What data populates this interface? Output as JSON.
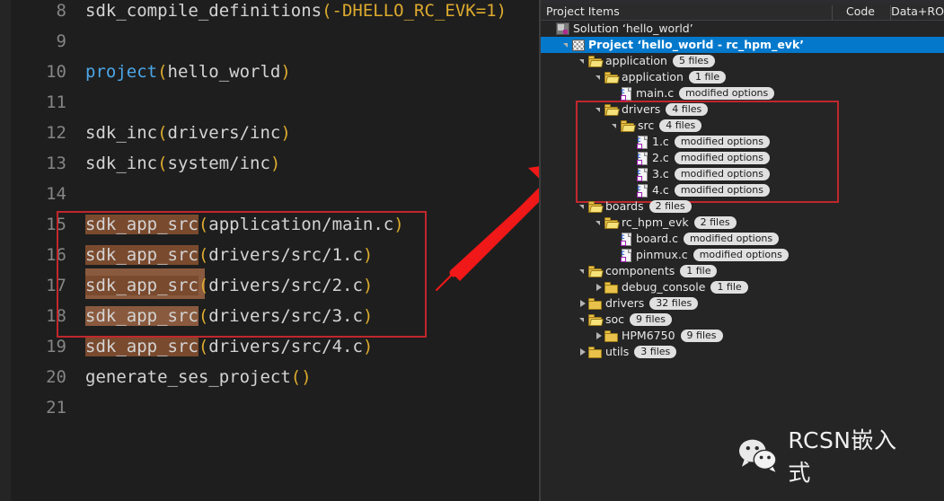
{
  "editor": {
    "lines": [
      {
        "num": "8",
        "parts": [
          {
            "t": "sdk_compile_definitions",
            "c": "plain"
          },
          {
            "t": "(-DHELLO_RC_EVK=1)",
            "c": "paren"
          }
        ]
      },
      {
        "num": "9",
        "parts": []
      },
      {
        "num": "10",
        "parts": [
          {
            "t": "project",
            "c": "fn"
          },
          {
            "t": "(",
            "c": "paren"
          },
          {
            "t": "hello_world",
            "c": "plain"
          },
          {
            "t": ")",
            "c": "paren"
          }
        ]
      },
      {
        "num": "11",
        "parts": []
      },
      {
        "num": "12",
        "parts": [
          {
            "t": "sdk_inc",
            "c": "plain"
          },
          {
            "t": "(",
            "c": "paren"
          },
          {
            "t": "drivers/inc",
            "c": "plain"
          },
          {
            "t": ")",
            "c": "paren"
          }
        ]
      },
      {
        "num": "13",
        "parts": [
          {
            "t": "sdk_inc",
            "c": "plain"
          },
          {
            "t": "(",
            "c": "paren"
          },
          {
            "t": "system/inc",
            "c": "plain"
          },
          {
            "t": ")",
            "c": "paren"
          }
        ]
      },
      {
        "num": "14",
        "parts": []
      },
      {
        "num": "15",
        "parts": [
          {
            "t": "sdk_app_src",
            "c": "sel"
          },
          {
            "t": "(",
            "c": "paren"
          },
          {
            "t": "application/main.c",
            "c": "plain"
          },
          {
            "t": ")",
            "c": "paren"
          }
        ]
      },
      {
        "num": "16",
        "parts": [
          {
            "t": "sdk_app_src",
            "c": "sel"
          },
          {
            "t": "(",
            "c": "paren"
          },
          {
            "t": "drivers/src/1.c",
            "c": "plain"
          },
          {
            "t": ")",
            "c": "paren"
          }
        ]
      },
      {
        "num": "17",
        "parts": [
          {
            "t": "sdk_app_src",
            "c": "sel"
          },
          {
            "t": "(",
            "c": "paren"
          },
          {
            "t": "drivers/src/2.c",
            "c": "plain"
          },
          {
            "t": ")",
            "c": "paren"
          }
        ]
      },
      {
        "num": "18",
        "parts": [
          {
            "t": "sdk_app_src",
            "c": "sellite"
          },
          {
            "t": "(",
            "c": "paren"
          },
          {
            "t": "drivers/src/3.c",
            "c": "plain"
          },
          {
            "t": ")",
            "c": "paren"
          }
        ]
      },
      {
        "num": "19",
        "parts": [
          {
            "t": "sdk_app_src",
            "c": "sel"
          },
          {
            "t": "(",
            "c": "paren"
          },
          {
            "t": "drivers/src/4.c",
            "c": "plain"
          },
          {
            "t": ")",
            "c": "paren"
          }
        ]
      },
      {
        "num": "20",
        "parts": [
          {
            "t": "generate_ses_project",
            "c": "plain"
          },
          {
            "t": "()",
            "c": "paren"
          }
        ]
      },
      {
        "num": "21",
        "parts": []
      }
    ],
    "annotation_color": "#c0272d",
    "selection_color": "#7a4a2e"
  },
  "panel": {
    "header": {
      "col_items": "Project Items",
      "col_code": "Code",
      "col_dataro": "Data+RO"
    },
    "selection_color": "#0479cc",
    "tree": [
      {
        "indent": 0,
        "twisty": "none",
        "icon": "solution-icon",
        "label": "Solution ‘hello_world’",
        "badge": "",
        "bold": false,
        "selected": false
      },
      {
        "indent": 1,
        "twisty": "open",
        "icon": "project-icon",
        "label": "Project ‘hello_world - rc_hpm_evk’",
        "badge": "",
        "bold": true,
        "selected": true
      },
      {
        "indent": 2,
        "twisty": "open",
        "icon": "folder-open-icon",
        "label": "application",
        "badge": "5 files",
        "bold": false,
        "selected": false
      },
      {
        "indent": 3,
        "twisty": "open",
        "icon": "folder-open-icon",
        "label": "application",
        "badge": "1 file",
        "bold": false,
        "selected": false
      },
      {
        "indent": 4,
        "twisty": "none",
        "icon": "c-file-icon",
        "label": "main.c",
        "badge": "modified options",
        "bold": false,
        "selected": false
      },
      {
        "indent": 3,
        "twisty": "open",
        "icon": "folder-open-icon",
        "label": "drivers",
        "badge": "4 files",
        "bold": false,
        "selected": false
      },
      {
        "indent": 4,
        "twisty": "open",
        "icon": "folder-open-icon",
        "label": "src",
        "badge": "4 files",
        "bold": false,
        "selected": false
      },
      {
        "indent": 5,
        "twisty": "none",
        "icon": "c-file-icon",
        "label": "1.c",
        "badge": "modified options",
        "bold": false,
        "selected": false
      },
      {
        "indent": 5,
        "twisty": "none",
        "icon": "c-file-icon",
        "label": "2.c",
        "badge": "modified options",
        "bold": false,
        "selected": false
      },
      {
        "indent": 5,
        "twisty": "none",
        "icon": "c-file-icon",
        "label": "3.c",
        "badge": "modified options",
        "bold": false,
        "selected": false
      },
      {
        "indent": 5,
        "twisty": "none",
        "icon": "c-file-icon",
        "label": "4.c",
        "badge": "modified options",
        "bold": false,
        "selected": false
      },
      {
        "indent": 2,
        "twisty": "open",
        "icon": "folder-open-icon",
        "label": "boards",
        "badge": "2 files",
        "bold": false,
        "selected": false
      },
      {
        "indent": 3,
        "twisty": "open",
        "icon": "folder-open-icon",
        "label": "rc_hpm_evk",
        "badge": "2 files",
        "bold": false,
        "selected": false
      },
      {
        "indent": 4,
        "twisty": "none",
        "icon": "c-file-icon",
        "label": "board.c",
        "badge": "modified options",
        "bold": false,
        "selected": false
      },
      {
        "indent": 4,
        "twisty": "none",
        "icon": "c-file-icon",
        "label": "pinmux.c",
        "badge": "modified options",
        "bold": false,
        "selected": false
      },
      {
        "indent": 2,
        "twisty": "open",
        "icon": "folder-open-icon",
        "label": "components",
        "badge": "1 file",
        "bold": false,
        "selected": false
      },
      {
        "indent": 3,
        "twisty": "closed",
        "icon": "folder-icon",
        "label": "debug_console",
        "badge": "1 file",
        "bold": false,
        "selected": false
      },
      {
        "indent": 2,
        "twisty": "closed",
        "icon": "folder-icon",
        "label": "drivers",
        "badge": "32 files",
        "bold": false,
        "selected": false
      },
      {
        "indent": 2,
        "twisty": "open",
        "icon": "folder-open-icon",
        "label": "soc",
        "badge": "9 files",
        "bold": false,
        "selected": false
      },
      {
        "indent": 3,
        "twisty": "closed",
        "icon": "folder-icon",
        "label": "HPM6750",
        "badge": "9 files",
        "bold": false,
        "selected": false
      },
      {
        "indent": 2,
        "twisty": "closed",
        "icon": "folder-icon",
        "label": "utils",
        "badge": "3 files",
        "bold": false,
        "selected": false
      }
    ]
  },
  "watermark": {
    "label": "RCSN嵌入式"
  }
}
